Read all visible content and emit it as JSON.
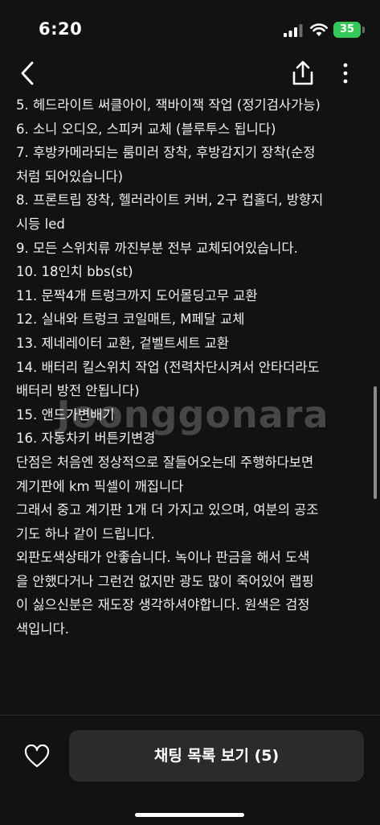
{
  "status_bar": {
    "time": "6:20",
    "battery_percent": "35",
    "battery_color": "#35c759",
    "icons": [
      "signal-icon",
      "wifi-icon",
      "battery-icon"
    ]
  },
  "nav": {
    "icons": [
      "back-icon",
      "share-icon",
      "more-icon"
    ]
  },
  "description_lines": [
    "5. 헤드라이트 써클아이, 잭바이잭 작업 (정기검사가능)",
    "6. 소니 오디오, 스피커 교체 (블루투스 됩니다)",
    "7. 후방카메라되는 룸미러 장착, 후방감지기 장착(순정",
    "처럼 되어있습니다)",
    "8. 프론트립 장착, 헬러라이트 커버, 2구 컵홀더, 방향지",
    "시등 led",
    "9. 모든 스위치류 까진부분 전부 교체되어있습니다.",
    "10. 18인치 bbs(st)",
    "11. 문짝4개 트렁크까지 도어몰딩고무 교환",
    "12. 실내와 트렁크 코일매트, M페달 교체",
    "13. 제네레이터 교환, 겉벨트세트 교환",
    "14. 배터리 킬스위치 작업 (전력차단시켜서 안타더라도",
    "배터리 방전 안됩니다)",
    "15. 앤드가변배기",
    "16. 자동차키 버튼키변경",
    "단점은 처음엔 정상적으로 잘들어오는데 주행하다보면",
    "계기판에 km 픽셀이 깨집니다",
    "그래서 중고 계기판 1개 더 가지고 있으며, 여분의 공조",
    "기도 하나 같이 드립니다.",
    "외판도색상태가 안좋습니다. 녹이나 판금을 해서 도색",
    "을 안했다거나 그런건 없지만 광도 많이 죽어있어 랩핑",
    "이 싫으신분은 재도장 생각하셔야합니다. 원색은 검정",
    "색입니다."
  ],
  "watermark": "Joonggonara",
  "bottom": {
    "like_icon": "heart-icon",
    "chat_button_label": "채팅 목록 보기 (5)"
  }
}
